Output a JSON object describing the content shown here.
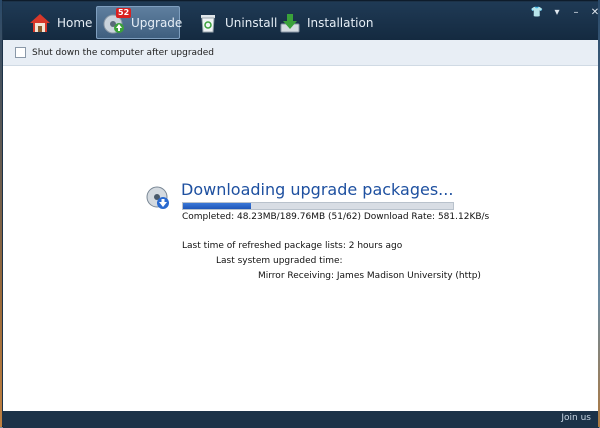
{
  "tabs": {
    "home": "Home",
    "upgrade": "Upgrade",
    "upgrade_badge": "52",
    "uninstall": "Uninstall",
    "installation": "Installation"
  },
  "options": {
    "shutdown_label": "Shut down the computer after upgraded",
    "shutdown_checked": false
  },
  "status": {
    "heading": "Downloading upgrade packages...",
    "progress": 0.25,
    "completed_line": "Completed: 48.23MB/189.76MB (51/62) Download Rate: 581.12KB/s",
    "last_refresh": "Last time of refreshed package lists: 2 hours ago",
    "last_upgraded": "Last system upgraded time:",
    "mirror": "Mirror Receiving: James Madison University (http)"
  },
  "footer": {
    "join_us": "Join us"
  },
  "colors": {
    "accent": "#1e50a0",
    "titlebar": "#1c3248",
    "badge": "#d9201f"
  }
}
